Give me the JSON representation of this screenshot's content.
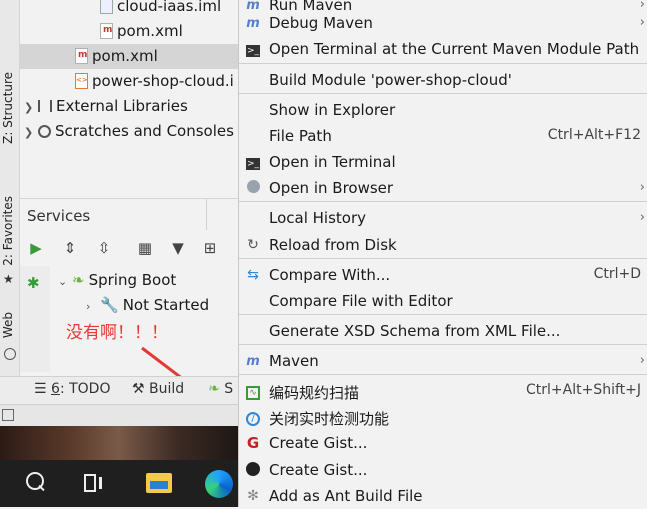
{
  "left_strip": {
    "structure": "Z: Structure",
    "favorites": "2: Favorites",
    "web": "Web"
  },
  "tree": [
    {
      "label": "cloud-iaas.iml",
      "type": "iml"
    },
    {
      "label": "pom.xml",
      "type": "maven"
    },
    {
      "label": "pom.xml",
      "type": "maven",
      "selected": true
    },
    {
      "label": "power-shop-cloud.i",
      "type": "xml"
    },
    {
      "label": "External Libraries",
      "type": "lib"
    },
    {
      "label": "Scratches and Consoles",
      "type": "scratch"
    }
  ],
  "services": {
    "title": "Services",
    "spring_boot": "Spring Boot",
    "not_started": "Not Started",
    "annotation": "没有啊！！！"
  },
  "bottom_tabs": {
    "todo_num": "6",
    "todo": ": TODO",
    "build": "Build",
    "s": "S"
  },
  "menu": {
    "items": [
      {
        "label": "Run Maven",
        "icon": "maven-icon",
        "submenu": true
      },
      {
        "label": "Debug Maven",
        "icon": "maven-icon",
        "submenu": true
      },
      {
        "label": "Open Terminal at the Current Maven Module Path",
        "icon": "terminal-icon"
      },
      {
        "label": "Build Module 'power-shop-cloud'"
      },
      {
        "label": "Show in Explorer"
      },
      {
        "label": "File Path",
        "shortcut": "Ctrl+Alt+F12"
      },
      {
        "label": "Open in Terminal",
        "icon": "terminal-icon"
      },
      {
        "label": "Open in Browser",
        "icon": "globe-icon",
        "submenu": true
      },
      {
        "label": "Local History",
        "submenu": true
      },
      {
        "label": "Reload from Disk",
        "icon": "reload-icon"
      },
      {
        "label": "Compare With...",
        "icon": "compare-icon",
        "shortcut": "Ctrl+D"
      },
      {
        "label": "Compare File with Editor"
      },
      {
        "label": "Generate XSD Schema from XML File..."
      },
      {
        "label": "Maven",
        "icon": "maven-icon",
        "submenu": true
      },
      {
        "label": "编码规约扫描",
        "icon": "scan-icon",
        "shortcut": "Ctrl+Alt+Shift+J"
      },
      {
        "label": "关闭实时检测功能",
        "icon": "disable-icon"
      },
      {
        "label": "Create Gist...",
        "icon": "gitee-icon"
      },
      {
        "label": "Create Gist...",
        "icon": "github-icon"
      },
      {
        "label": "Add as Ant Build File",
        "icon": "ant-icon"
      }
    ]
  },
  "colors": {
    "menu_bg": "#f2f2f2",
    "annotation": "#e53935",
    "arrow": "#e53935",
    "selection": "#d5d5d5"
  }
}
